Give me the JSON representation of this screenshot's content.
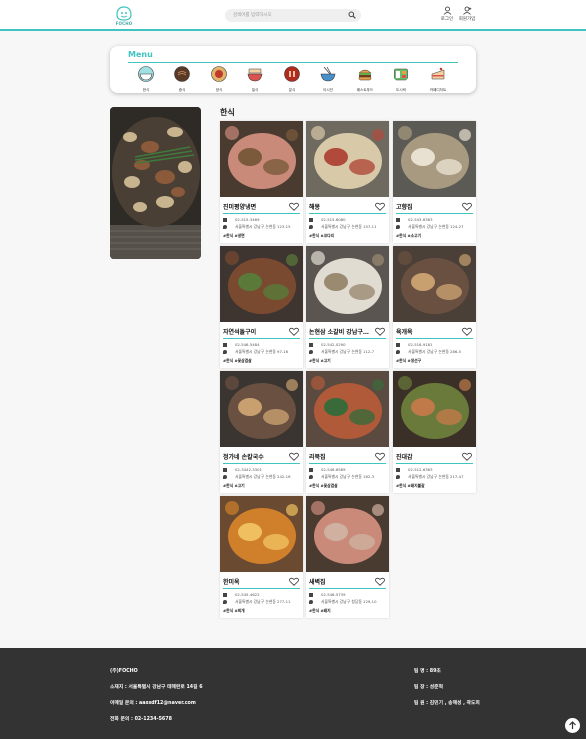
{
  "header": {
    "logo_text": "FOCHO",
    "search_placeholder": "검색어를 입력하시오",
    "login_label": "로그인",
    "signup_label": "회원가입"
  },
  "menu": {
    "title": "Menu",
    "categories": [
      {
        "label": "한식",
        "icon": "rice-bowl-icon"
      },
      {
        "label": "중식",
        "icon": "jajangmyeon-icon"
      },
      {
        "label": "양식",
        "icon": "pasta-icon"
      },
      {
        "label": "일식",
        "icon": "ramen-icon"
      },
      {
        "label": "분식",
        "icon": "tteokbokki-icon"
      },
      {
        "label": "아시안",
        "icon": "noodle-bowl-icon"
      },
      {
        "label": "패스트푸드",
        "icon": "burger-icon"
      },
      {
        "label": "도시락",
        "icon": "lunchbox-icon"
      },
      {
        "label": "카페디저트",
        "icon": "cake-icon"
      }
    ]
  },
  "section_title": "한식",
  "restaurants": [
    {
      "name": "진미평양냉면",
      "phone": "02-515-3469",
      "address": "서울특별시 강남구 논현동 123-15",
      "tags": "#한식 #냉면"
    },
    {
      "name": "해몽",
      "phone": "02-515-6080",
      "address": "서울특별시 강남구 논현동 157-11",
      "tags": "#한식 #코다리"
    },
    {
      "name": "고향집",
      "phone": "02-543-6363",
      "address": "서울특별시 강남구 논현동 124-27",
      "tags": "#한식 #소고기"
    },
    {
      "name": "자연석돌구이",
      "phone": "02-546-5484",
      "address": "서울특별시 강남구 논현동 97-16",
      "tags": "#한식 #꽃삼겹살"
    },
    {
      "name": "논현삼 소갈비 강남구…",
      "phone": "02-542-0290",
      "address": "서울특별시 강남구 논현동 112-7",
      "tags": "#한식 #고기"
    },
    {
      "name": "육개옥",
      "phone": "02-516-9181",
      "address": "서울특별시 강남구 논현동 286-5",
      "tags": "#한식 #생선구"
    },
    {
      "name": "정가네 손칼국수",
      "phone": "02-3442-3301",
      "address": "서울특별시 강남구 논현동 242-16",
      "tags": "#한식 #고기"
    },
    {
      "name": "리북집",
      "phone": "02-546-6589",
      "address": "서울특별시 강남구 논현동 162-3",
      "tags": "#한식 #꽃삼겹살"
    },
    {
      "name": "진대감",
      "phone": "02-512-6363",
      "address": "서울특별시 강남구 논현동 217-47",
      "tags": "#한식 #돼지불갈"
    },
    {
      "name": "한미옥",
      "phone": "02-545-4622",
      "address": "서울특별시 강남구 논현동 277-11",
      "tags": "#한식 #찌개"
    },
    {
      "name": "새벽집",
      "phone": "02-546-5739",
      "address": "서울특별시 강남구 청담동 129-10",
      "tags": "#한식 #돼지"
    }
  ],
  "footer": {
    "company": "(주)FOCHO",
    "address": "소재지 : 서울특별시 강남구 테헤란로 14길 6",
    "email": "이메일 문의 : aassdf12@naver.com",
    "phone": "전화 문의 : 02-1234-5678",
    "team_name": "팀 명 : 89조",
    "team_leader": "팀 장 : 성준혁",
    "team_members": "팀 원 : 김민기 , 송해성 , 곽도희"
  },
  "colors": {
    "accent": "#3fc4c0",
    "footer_bg": "#333333"
  }
}
